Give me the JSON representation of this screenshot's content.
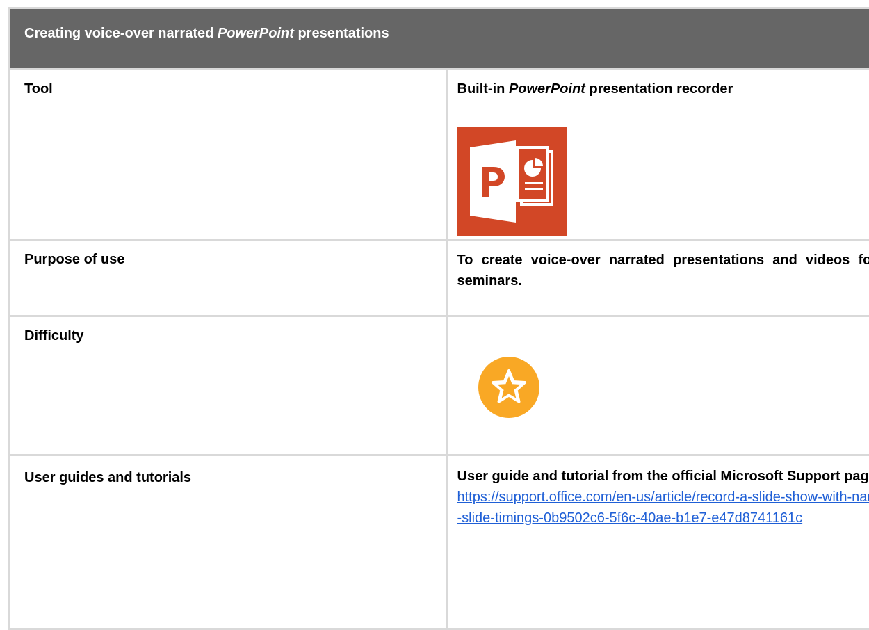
{
  "header": {
    "title_pre": "Creating voice-over narrated ",
    "title_italic": "PowerPoint",
    "title_post": " presentations"
  },
  "rows": {
    "tool": {
      "label": "Tool",
      "value_pre": "Built-in ",
      "value_italic": "PowerPoint",
      "value_post": " presentation recorder",
      "logo_icon": "powerpoint-logo-icon",
      "logo_color": "#d24726"
    },
    "purpose": {
      "label": "Purpose of use",
      "value": "To create voice-over narrated presentations and videos for lectures, seminars."
    },
    "difficulty": {
      "label": "Difficulty",
      "icon": "star-badge-icon",
      "level": 1,
      "icon_color": "#f9a825"
    },
    "guides": {
      "label": "User guides and tutorials",
      "title": "User guide and tutorial from the official Microsoft Support page:",
      "link": "https://support.office.com/en-us/article/record-a-slide-show-with-narration-and-slide-timings-0b9502c6-5f6c-40ae-b1e7-e47d8741161c",
      "link_color": "#1f5fd6"
    }
  },
  "colors": {
    "header_bg": "#666666",
    "border": "#d9d9d9"
  }
}
